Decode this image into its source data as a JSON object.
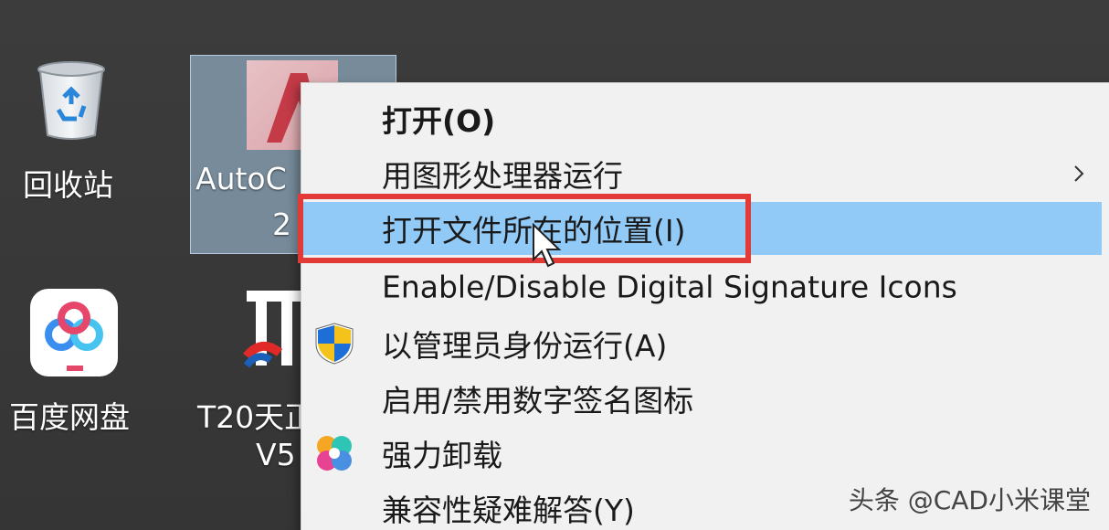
{
  "desktop": {
    "icons": [
      {
        "label": "回收站"
      },
      {
        "label_line1": "AutoC",
        "label_line2": "2"
      },
      {
        "label": "百度网盘"
      },
      {
        "label_line1": "T20天正",
        "label_line2": "V5"
      }
    ]
  },
  "context_menu": {
    "items": [
      {
        "label": "打开(O)",
        "bold": true
      },
      {
        "label": "用图形处理器运行",
        "has_submenu": true
      },
      {
        "label": "打开文件所在的位置(I)",
        "highlighted": true
      },
      {
        "label": "Enable/Disable Digital Signature Icons"
      },
      {
        "label": "以管理员身份运行(A)",
        "icon": "uac-shield-icon"
      },
      {
        "label": "启用/禁用数字签名图标"
      },
      {
        "label": "强力卸载",
        "icon": "uninstall-clover-icon"
      },
      {
        "label": "兼容性疑难解答(Y)"
      }
    ]
  },
  "watermark": "头条 @CAD小米课堂",
  "colors": {
    "highlight": "#91c9f7",
    "annotation_box": "#e23a37",
    "menu_background": "#f1f1f1"
  }
}
